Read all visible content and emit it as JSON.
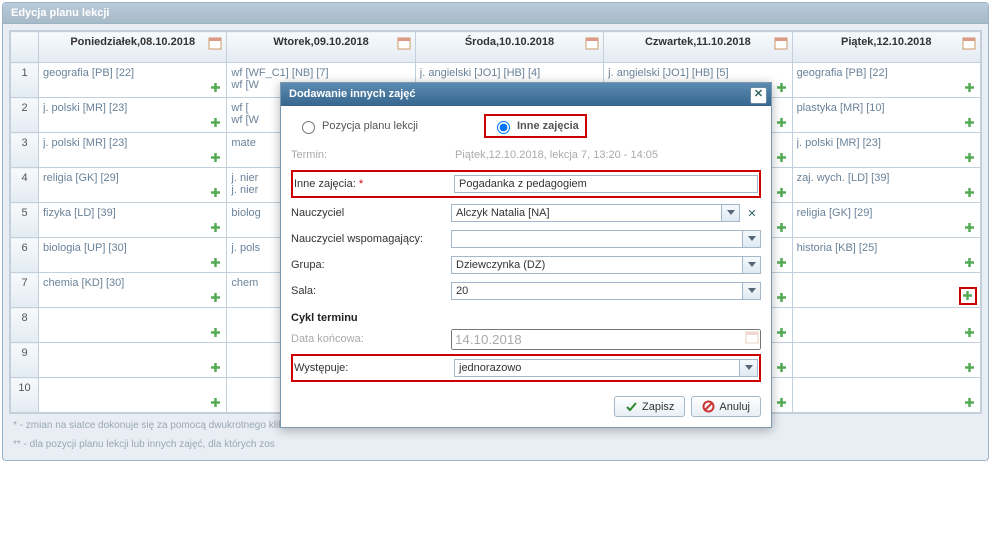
{
  "panel_title": "Edycja planu lekcji",
  "columns": [
    "Poniedziałek,08.10.2018",
    "Wtorek,09.10.2018",
    "Środa,10.10.2018",
    "Czwartek,11.10.2018",
    "Piątek,12.10.2018"
  ],
  "rows": [
    {
      "n": "1",
      "mon": "geografia [PB] [22]",
      "tue": "wf [WF_C1] [NB] [7]\nwf [W",
      "wed": "j. angielski [JO1] [HB] [4]",
      "thu": "j. angielski [JO1] [HB] [5]",
      "fri": "geografia [PB] [22]"
    },
    {
      "n": "2",
      "mon": "j. polski [MR] [23]",
      "tue": "wf [\nwf [W",
      "wed": "",
      "thu": "",
      "fri": "plastyka [MR] [10]"
    },
    {
      "n": "3",
      "mon": "j. polski [MR] [23]",
      "tue": "mate",
      "wed": "",
      "thu": "",
      "fri": "j. polski [MR] [23]"
    },
    {
      "n": "4",
      "mon": "religia [GK] [29]",
      "tue": "j. nier\nj. nier",
      "wed": "",
      "thu": "",
      "fri": "zaj. wych. [LD] [39]"
    },
    {
      "n": "5",
      "mon": "fizyka [LD] [39]",
      "tue": "biolog",
      "wed": "",
      "thu": "",
      "fri": "religia [GK] [29]"
    },
    {
      "n": "6",
      "mon": "biologia [UP] [30]",
      "tue": "j. pols",
      "wed": "",
      "thu": "",
      "fri": "historia [KB] [25]"
    },
    {
      "n": "7",
      "mon": "chemia [KD] [30]",
      "tue": "chem",
      "wed": "",
      "thu": "",
      "fri": ""
    },
    {
      "n": "8",
      "mon": "",
      "tue": "",
      "wed": "",
      "thu": "",
      "fri": ""
    },
    {
      "n": "9",
      "mon": "",
      "tue": "",
      "wed": "",
      "thu": "",
      "fri": ""
    },
    {
      "n": "10",
      "mon": "",
      "tue": "",
      "wed": "",
      "thu": "",
      "fri": ""
    }
  ],
  "footnote1": "* - zmian na siatce dokonuje się za pomocą dwukrotnego klik",
  "footnote2": "** - dla pozycji planu lekcji lub innych zajęć, dla których zos",
  "modal": {
    "title": "Dodawanie innych zajęć",
    "radio_plan": "Pozycja planu lekcji",
    "radio_other": "Inne zajęcia",
    "lbl_termin": "Termin:",
    "val_termin": "Piątek,12.10.2018, lekcja 7, 13:20 - 14:05",
    "lbl_inne": "Inne zajęcia:",
    "val_inne": "Pogadanka z pedagogiem",
    "lbl_nau": "Nauczyciel",
    "val_nau": "Alczyk Natalia [NA]",
    "lbl_nau2": "Nauczyciel wspomagający:",
    "val_nau2": "",
    "lbl_grupa": "Grupa:",
    "val_grupa": "Dziewczynka (DZ)",
    "lbl_sala": "Sala:",
    "val_sala": "20",
    "sec_cykl": "Cykl terminu",
    "lbl_data": "Data końcowa:",
    "val_data": "14.10.2018",
    "lbl_wyst": "Występuje:",
    "val_wyst": "jednorazowo",
    "btn_save": "Zapisz",
    "btn_cancel": "Anuluj"
  }
}
